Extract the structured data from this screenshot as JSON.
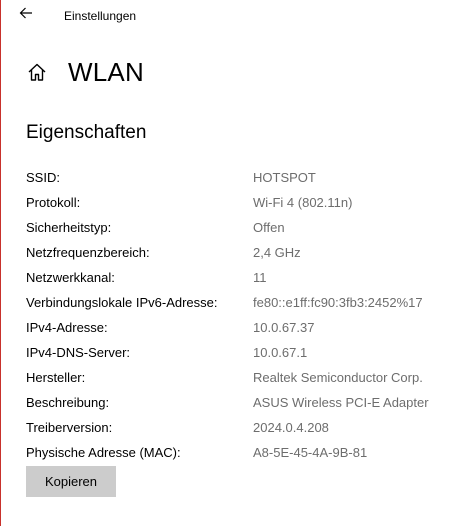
{
  "window": {
    "app_title": "Einstellungen",
    "accent_edge_color": "#c8312c"
  },
  "header": {
    "back_icon": "back-arrow-icon",
    "home_icon": "home-icon",
    "page_title": "WLAN"
  },
  "properties": {
    "section_title": "Eigenschaften",
    "rows": [
      {
        "label": "SSID:",
        "value": "HOTSPOT"
      },
      {
        "label": "Protokoll:",
        "value": "Wi-Fi 4 (802.11n)"
      },
      {
        "label": "Sicherheitstyp:",
        "value": "Offen"
      },
      {
        "label": "Netzfrequenzbereich:",
        "value": "2,4 GHz"
      },
      {
        "label": "Netzwerkkanal:",
        "value": "11"
      },
      {
        "label": "Verbindungslokale IPv6-Adresse:",
        "value": "fe80::e1ff:fc90:3fb3:2452%17"
      },
      {
        "label": "IPv4-Adresse:",
        "value": "10.0.67.37"
      },
      {
        "label": "IPv4-DNS-Server:",
        "value": "10.0.67.1"
      },
      {
        "label": "Hersteller:",
        "value": "Realtek Semiconductor Corp."
      },
      {
        "label": "Beschreibung:",
        "value": "ASUS Wireless PCI-E Adapter"
      },
      {
        "label": "Treiberversion:",
        "value": "2024.0.4.208"
      },
      {
        "label": "Physische Adresse (MAC):",
        "value": "A8-5E-45-4A-9B-81"
      }
    ],
    "copy_button_label": "Kopieren"
  }
}
